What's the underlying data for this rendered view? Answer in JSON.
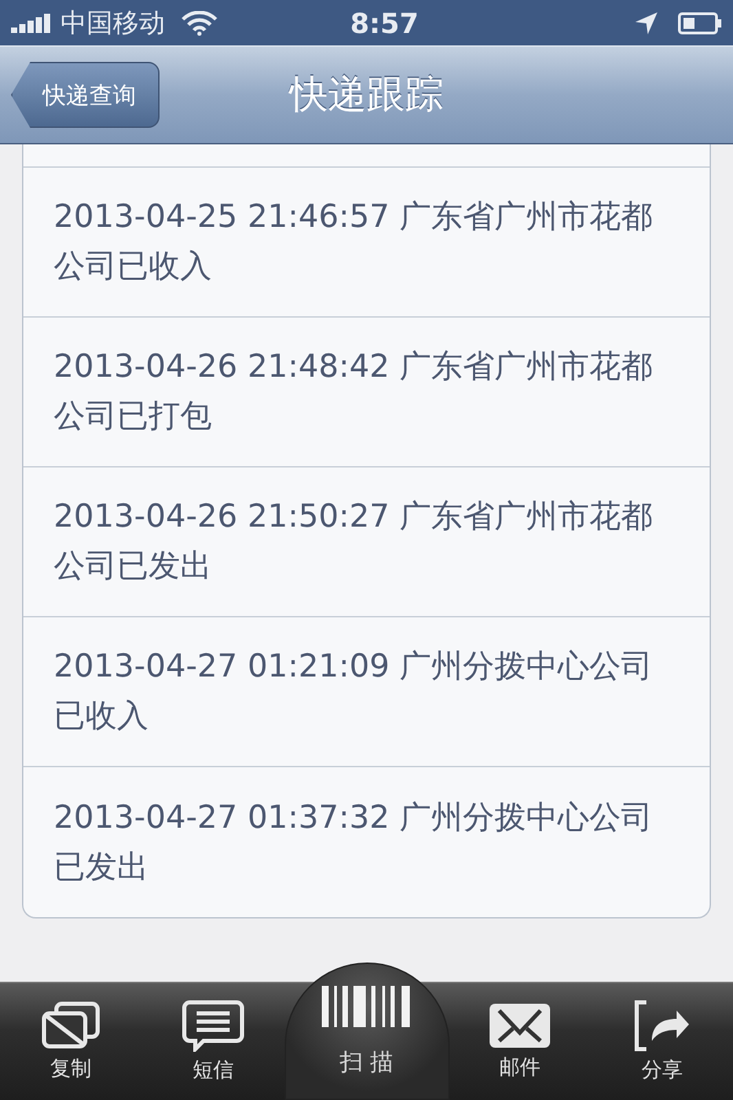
{
  "status_bar": {
    "carrier": "中国移动",
    "time": "8:57"
  },
  "nav": {
    "back": "快递查询",
    "title": "快递跟踪"
  },
  "records": [
    {
      "text": "2013-04-25 21:46:57 广东省广州市花都公司已收入"
    },
    {
      "text": "2013-04-26 21:48:42 广东省广州市花都公司已打包"
    },
    {
      "text": "2013-04-26 21:50:27 广东省广州市花都公司已发出"
    },
    {
      "text": "2013-04-27 01:21:09 广州分拨中心公司已收入"
    },
    {
      "text": "2013-04-27 01:37:32 广州分拨中心公司已发出"
    }
  ],
  "toolbar": [
    {
      "kind": "copy",
      "label": "复制"
    },
    {
      "kind": "message",
      "label": "短信"
    },
    {
      "kind": "scan",
      "label": "扫 描"
    },
    {
      "kind": "mail",
      "label": "邮件"
    },
    {
      "kind": "share",
      "label": "分享"
    }
  ]
}
